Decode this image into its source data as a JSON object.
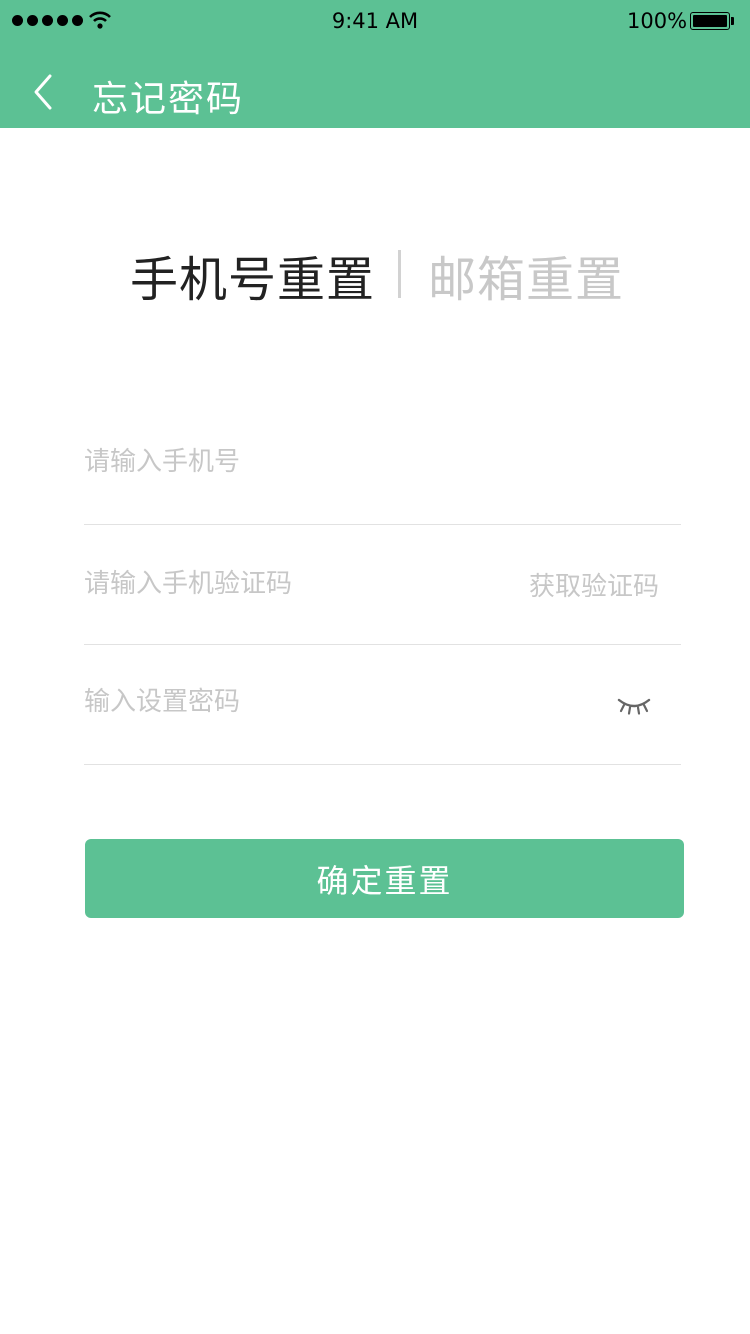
{
  "status_bar": {
    "time": "9:41 AM",
    "battery_percent": "100%",
    "signal_icon": "cellular-signal-icon",
    "wifi_icon": "wifi-icon",
    "battery_icon": "battery-icon"
  },
  "nav": {
    "title": "忘记密码",
    "back_icon": "chevron-left-icon"
  },
  "tabs": {
    "phone": "手机号重置",
    "email": "邮箱重置",
    "active": "phone"
  },
  "form": {
    "phone_placeholder": "请输入手机号",
    "code_placeholder": "请输入手机验证码",
    "get_code_label": "获取验证码",
    "password_placeholder": "输入设置密码",
    "password_toggle_icon": "eye-closed-icon"
  },
  "submit_label": "确定重置",
  "colors": {
    "primary": "#5cc194",
    "tab_active": "#222222",
    "tab_inactive": "#c8c8c8",
    "placeholder": "#c7c7c7"
  }
}
